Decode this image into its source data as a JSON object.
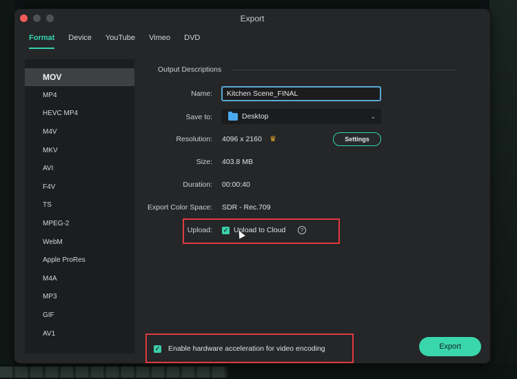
{
  "window": {
    "title": "Export"
  },
  "tabs": [
    {
      "label": "Format",
      "active": true
    },
    {
      "label": "Device"
    },
    {
      "label": "YouTube"
    },
    {
      "label": "Vimeo"
    },
    {
      "label": "DVD"
    }
  ],
  "formats": [
    "MOV",
    "MP4",
    "HEVC MP4",
    "M4V",
    "MKV",
    "AVI",
    "F4V",
    "TS",
    "MPEG-2",
    "WebM",
    "Apple ProRes",
    "M4A",
    "MP3",
    "GIF",
    "AV1"
  ],
  "selected_format": "MOV",
  "output": {
    "section_title": "Output Descriptions",
    "name_label": "Name:",
    "name_value": "Kitchen Scene_FINAL",
    "save_label": "Save to:",
    "save_value": "Desktop",
    "resolution_label": "Resolution:",
    "resolution_value": "4096 x 2160",
    "settings_label": "Settings",
    "size_label": "Size:",
    "size_value": "403.8 MB",
    "duration_label": "Duration:",
    "duration_value": "00:00:40",
    "color_label": "Export Color Space:",
    "color_value": "SDR - Rec.709",
    "upload_label": "Upload:",
    "upload_text": "Upload to Cloud",
    "upload_checked": true
  },
  "hw_accel": {
    "text": "Enable hardware acceleration for video encoding",
    "checked": true
  },
  "export_label": "Export",
  "colors": {
    "accent": "#35d5b0",
    "highlight": "#e23a3f",
    "window": "#242628"
  }
}
